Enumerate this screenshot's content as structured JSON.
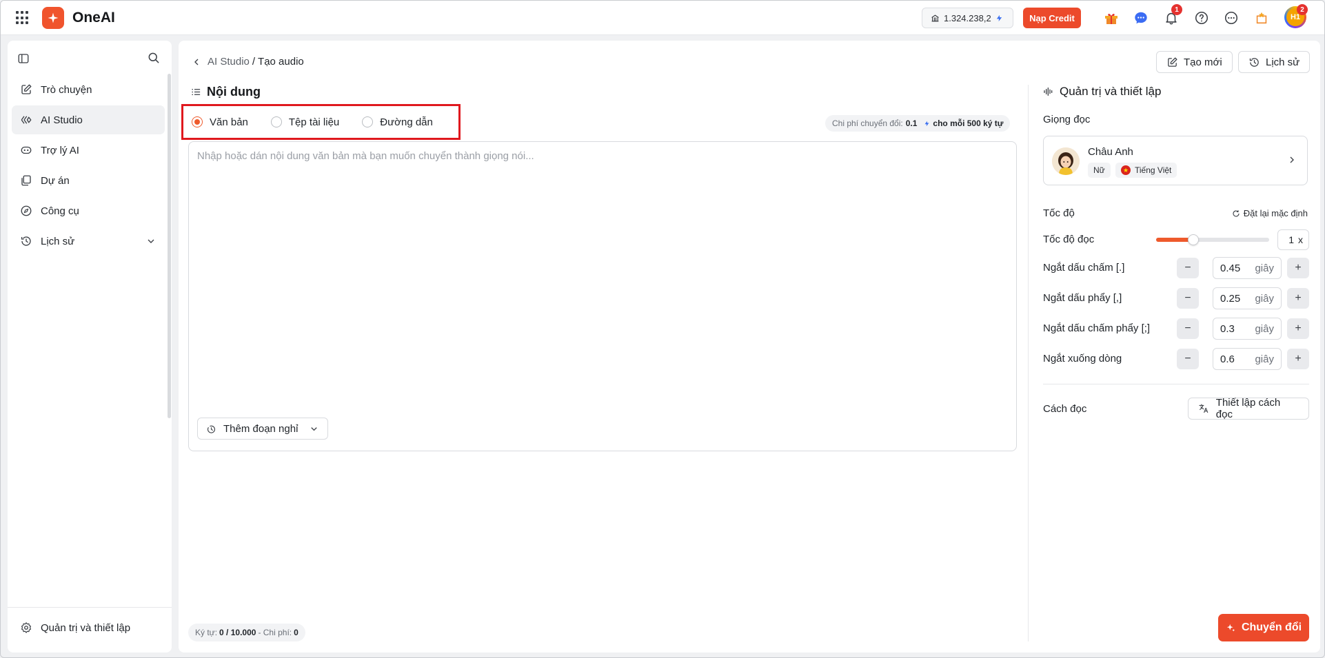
{
  "app": {
    "brand": "OneAI",
    "credit_balance": "1.324.238,2",
    "topup_label": "Nạp Credit",
    "notification_count": "1",
    "avatar_initials": "H1",
    "avatar_badge": "2",
    "accent_color": "#ec4a2b"
  },
  "sidebar": {
    "items": [
      {
        "label": "Trò chuyện",
        "icon": "edit-icon"
      },
      {
        "label": "AI Studio",
        "icon": "ai-studio-icon"
      },
      {
        "label": "Trợ lý AI",
        "icon": "assistant-icon"
      },
      {
        "label": "Dự án",
        "icon": "project-icon"
      },
      {
        "label": "Công cụ",
        "icon": "compass-icon"
      },
      {
        "label": "Lịch sử",
        "icon": "history-icon"
      }
    ],
    "footer_label": "Quản trị và thiết lập"
  },
  "header": {
    "breadcrumb_parent": "AI Studio",
    "breadcrumb_sep": "/",
    "breadcrumb_current": "Tạo audio",
    "new_label": "Tạo mới",
    "history_label": "Lịch sử"
  },
  "content": {
    "title": "Nội dung",
    "source_options": [
      "Văn bản",
      "Tệp tài liệu",
      "Đường dẫn"
    ],
    "selected_source": "Văn bản",
    "cost_prefix": "Chi phí chuyển đổi:",
    "cost_value": "0.1",
    "cost_suffix": "cho mỗi 500 ký tự",
    "placeholder": "Nhập hoặc dán nội dung văn bản mà bạn muốn chuyển thành giọng nói...",
    "pause_label": "Thêm đoạn nghỉ",
    "char_prefix": "Ký tự:",
    "char_value": "0 / 10.000",
    "cost_sep": "- Chi phí:",
    "cost_total": "0"
  },
  "settings": {
    "title": "Quản trị và thiết lập",
    "voice_label": "Giọng đọc",
    "voice_name": "Châu Anh",
    "voice_gender": "Nữ",
    "voice_language": "Tiếng Việt",
    "speed_section": "Tốc độ",
    "reset_label": "Đặt lại mặc định",
    "read_speed_label": "Tốc độ đọc",
    "read_speed_value": "1",
    "read_speed_unit": "x",
    "read_speed_fraction": 0.33,
    "pauses": [
      {
        "label": "Ngắt dấu chấm [.]",
        "value": "0.45",
        "unit": "giây"
      },
      {
        "label": "Ngắt dấu phẩy [,]",
        "value": "0.25",
        "unit": "giây"
      },
      {
        "label": "Ngắt dấu chấm phẩy [;]",
        "value": "0.3",
        "unit": "giây"
      },
      {
        "label": "Ngắt xuống dòng",
        "value": "0.6",
        "unit": "giây"
      }
    ],
    "reading_label": "Cách đọc",
    "reading_button": "Thiết lập cách đọc",
    "convert_label": "Chuyển đổi"
  }
}
